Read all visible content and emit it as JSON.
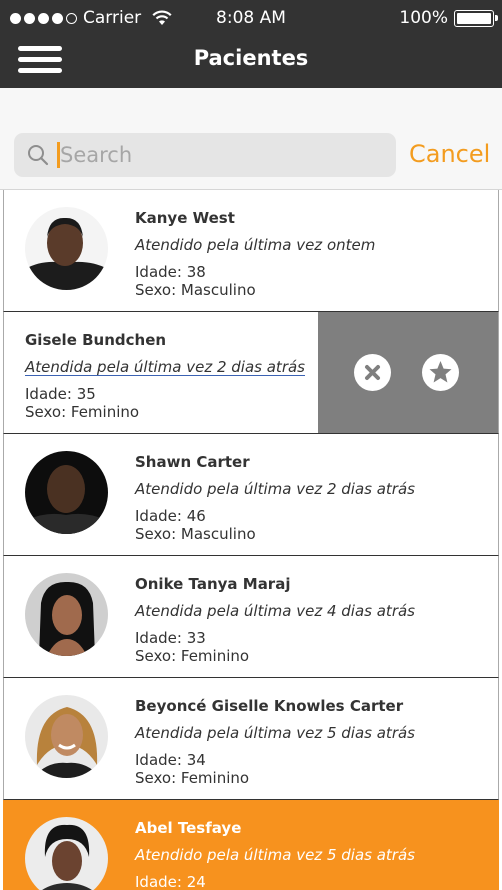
{
  "status_bar": {
    "carrier": "Carrier",
    "time": "8:08 AM",
    "battery": "100%"
  },
  "nav": {
    "title": "Pacientes"
  },
  "search": {
    "placeholder": "Search",
    "cancel_label": "Cancel"
  },
  "patients": [
    {
      "name": "Kanye West",
      "last_seen": "Atendido pela última vez ontem",
      "age": "Idade: 38",
      "sex": "Sexo: Masculino"
    },
    {
      "name": "Gisele Bundchen",
      "last_seen": "Atendida pela última vez 2 dias atrás",
      "age": "Idade: 35",
      "sex": "Sexo: Feminino"
    },
    {
      "name": "Shawn Carter",
      "last_seen": "Atendido pela última vez 2 dias atrás",
      "age": "Idade: 46",
      "sex": "Sexo: Masculino"
    },
    {
      "name": "Onike Tanya Maraj",
      "last_seen": "Atendida pela última vez 4 dias atrás",
      "age": "Idade: 33",
      "sex": "Sexo: Feminino"
    },
    {
      "name": "Beyoncé Giselle Knowles Carter",
      "last_seen": "Atendida pela última vez 5 dias atrás",
      "age": "Idade: 34",
      "sex": "Sexo: Feminino"
    },
    {
      "name": "Abel Tesfaye",
      "last_seen": "Atendido pela última vez 5 dias atrás",
      "age": "Idade: 24",
      "sex": ""
    }
  ],
  "colors": {
    "accent": "#f7921e",
    "bar": "#333333",
    "swipe_bg": "#7f7f7f"
  },
  "icons": {
    "delete": "x-circle-icon",
    "favorite": "star-circle-icon"
  }
}
